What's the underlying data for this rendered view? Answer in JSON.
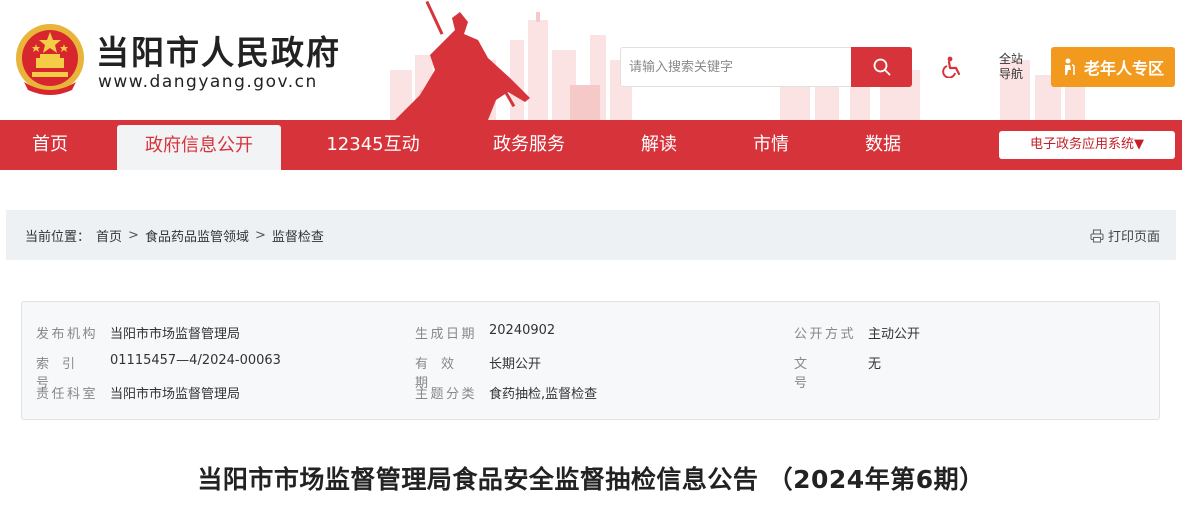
{
  "header": {
    "site_title": "当阳市人民政府",
    "site_url": "www.dangyang.gov.cn",
    "search": {
      "placeholder": "请输入搜索关键字"
    },
    "sitemap_label_line1": "全站",
    "sitemap_label_line2": "导航",
    "elder_label": "老年人专区"
  },
  "nav": {
    "items": [
      {
        "label": "首页"
      },
      {
        "label": "政府信息公开",
        "active": true
      },
      {
        "label": "12345互动"
      },
      {
        "label": "政务服务"
      },
      {
        "label": "解读"
      },
      {
        "label": "市情"
      },
      {
        "label": "数据"
      }
    ],
    "egov_label": "电子政务应用系统▼"
  },
  "breadcrumb": {
    "prefix": "当前位置：",
    "items": [
      "首页",
      "食品药品监管领域",
      "监督检查"
    ],
    "separator": ">",
    "print_label": "打印页面"
  },
  "meta": {
    "publisher_label": "发布机构",
    "publisher": "当阳市市场监督管理局",
    "date_label": "生成日期",
    "date": "20240902",
    "open_mode_label": "公开方式",
    "open_mode": "主动公开",
    "index_label": "索引号",
    "index": "01115457—4/2024-00063",
    "validity_label": "有效期",
    "validity": "长期公开",
    "doc_no_label": "文号",
    "doc_no": "无",
    "dept_label": "责任科室",
    "dept": "当阳市市场监督管理局",
    "topic_label": "主题分类",
    "topic": "食药抽检,监督检查"
  },
  "article": {
    "title": "当阳市市场监督管理局食品安全监督抽检信息公告 （2024年第6期）"
  },
  "colors": {
    "brand_red": "#d7333b",
    "elder_orange": "#f29a1d"
  }
}
